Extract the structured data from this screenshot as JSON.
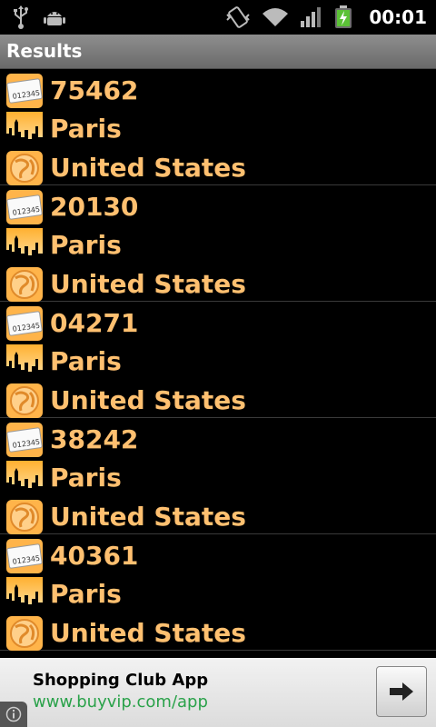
{
  "status_bar": {
    "time": "00:01",
    "icons": [
      "usb-icon",
      "android-debug-icon",
      "vibrate-icon",
      "wifi-icon",
      "signal-icon",
      "battery-charging-icon"
    ]
  },
  "title_bar": {
    "title": "Results"
  },
  "results": [
    {
      "postal_code": "75462",
      "city": "Paris",
      "country": "United States"
    },
    {
      "postal_code": "20130",
      "city": "Paris",
      "country": "United States"
    },
    {
      "postal_code": "04271",
      "city": "Paris",
      "country": "United States"
    },
    {
      "postal_code": "38242",
      "city": "Paris",
      "country": "United States"
    },
    {
      "postal_code": "40361",
      "city": "Paris",
      "country": "United States"
    }
  ],
  "ad": {
    "title": "Shopping Club App",
    "url": "www.buyvip.com/app"
  },
  "colors": {
    "result_text": "#ffc070",
    "ad_url": "#2aa24a",
    "title_bar": "#7c7c7c"
  }
}
